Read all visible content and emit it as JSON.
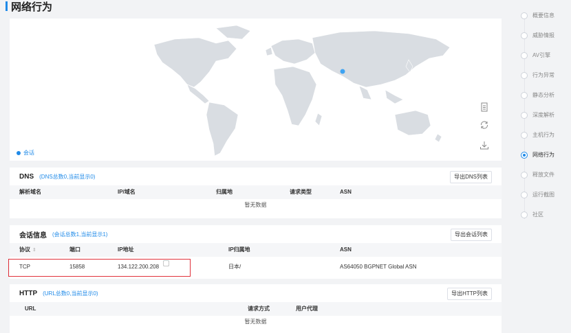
{
  "page": {
    "title": "网络行为"
  },
  "map": {
    "legend_label": "会话",
    "accent": "#1f8ae8",
    "land_color": "#d9dde2",
    "tools": [
      "document-icon",
      "refresh-icon",
      "download-icon"
    ]
  },
  "dns": {
    "title": "DNS",
    "summary": "(DNS总数0,当前显示0)",
    "export_label": "导出DNS列表",
    "columns": [
      "解析域名",
      "IP/域名",
      "归属地",
      "请求类型",
      "ASN"
    ],
    "empty_text": "暂无数据"
  },
  "sessions": {
    "title": "会话信息",
    "summary": "(会话总数1,当前显示1)",
    "export_label": "导出会话列表",
    "columns": [
      "协议",
      "端口",
      "IP地址",
      "IP归属地",
      "ASN"
    ],
    "rows": [
      {
        "protocol": "TCP",
        "port": "15858",
        "ip": "134.122.200.208",
        "location": "日本/",
        "asn": "AS64050 BGPNET Global ASN"
      }
    ]
  },
  "http": {
    "title": "HTTP",
    "summary": "(URL总数0,当前显示0)",
    "export_label": "导出HTTP列表",
    "columns": [
      "URL",
      "请求方式",
      "用户代理"
    ],
    "empty_text": "暂无数据"
  },
  "nav": {
    "items": [
      {
        "label": "概要信息",
        "active": false
      },
      {
        "label": "威胁情报",
        "active": false
      },
      {
        "label": "AV引擎",
        "active": false
      },
      {
        "label": "行为异常",
        "active": false
      },
      {
        "label": "静态分析",
        "active": false
      },
      {
        "label": "深度解析",
        "active": false
      },
      {
        "label": "主机行为",
        "active": false
      },
      {
        "label": "网络行为",
        "active": true
      },
      {
        "label": "释放文件",
        "active": false
      },
      {
        "label": "运行截图",
        "active": false
      },
      {
        "label": "社区",
        "active": false
      }
    ]
  }
}
